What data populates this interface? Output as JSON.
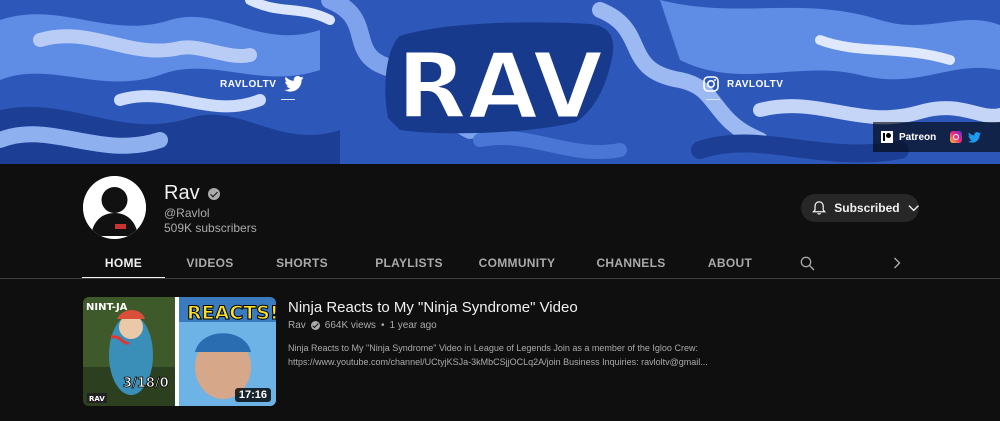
{
  "banner": {
    "logo_text": "RAV",
    "left_handle": "RAVLOLTV",
    "right_handle": "RAVLOLTV",
    "left_icon": "twitter-icon",
    "right_icon": "instagram-icon",
    "links": {
      "patreon_label": "Patreon",
      "icons": [
        "patreon-icon",
        "instagram-icon",
        "twitter-icon"
      ]
    }
  },
  "channel": {
    "name": "Rav",
    "handle": "@Ravlol",
    "subscribers": "509K subscribers",
    "subscribe_label": "Subscribed"
  },
  "tabs": [
    "HOME",
    "VIDEOS",
    "SHORTS",
    "PLAYLISTS",
    "COMMUNITY",
    "CHANNELS",
    "ABOUT"
  ],
  "active_tab": "HOME",
  "video": {
    "title": "Ninja Reacts to My \"Ninja Syndrome\" Video",
    "channel": "Rav",
    "views": "664K views",
    "separator": "•",
    "age": "1 year ago",
    "description_line1": "Ninja Reacts to My \"Ninja Syndrome\" Video in League of Legends Join as a member of the Igloo Crew:",
    "description_line2": "https://www.youtube.com/channel/UCtyjKSJa-3kMbCSjjOCLq2A/join Business Inquiries: ravloltv@gmail...",
    "duration": "17:16",
    "thumb_text_1": "NINT-JA",
    "thumb_text_2": "REACTS!",
    "thumb_text_3": "3/18/0",
    "thumb_badge": "RAV"
  },
  "colors": {
    "background": "#0f0f0f",
    "banner_blue": "#2f5bbf",
    "text_primary": "#f1f1f1",
    "text_secondary": "#aaaaaa",
    "button_bg": "#272727"
  }
}
